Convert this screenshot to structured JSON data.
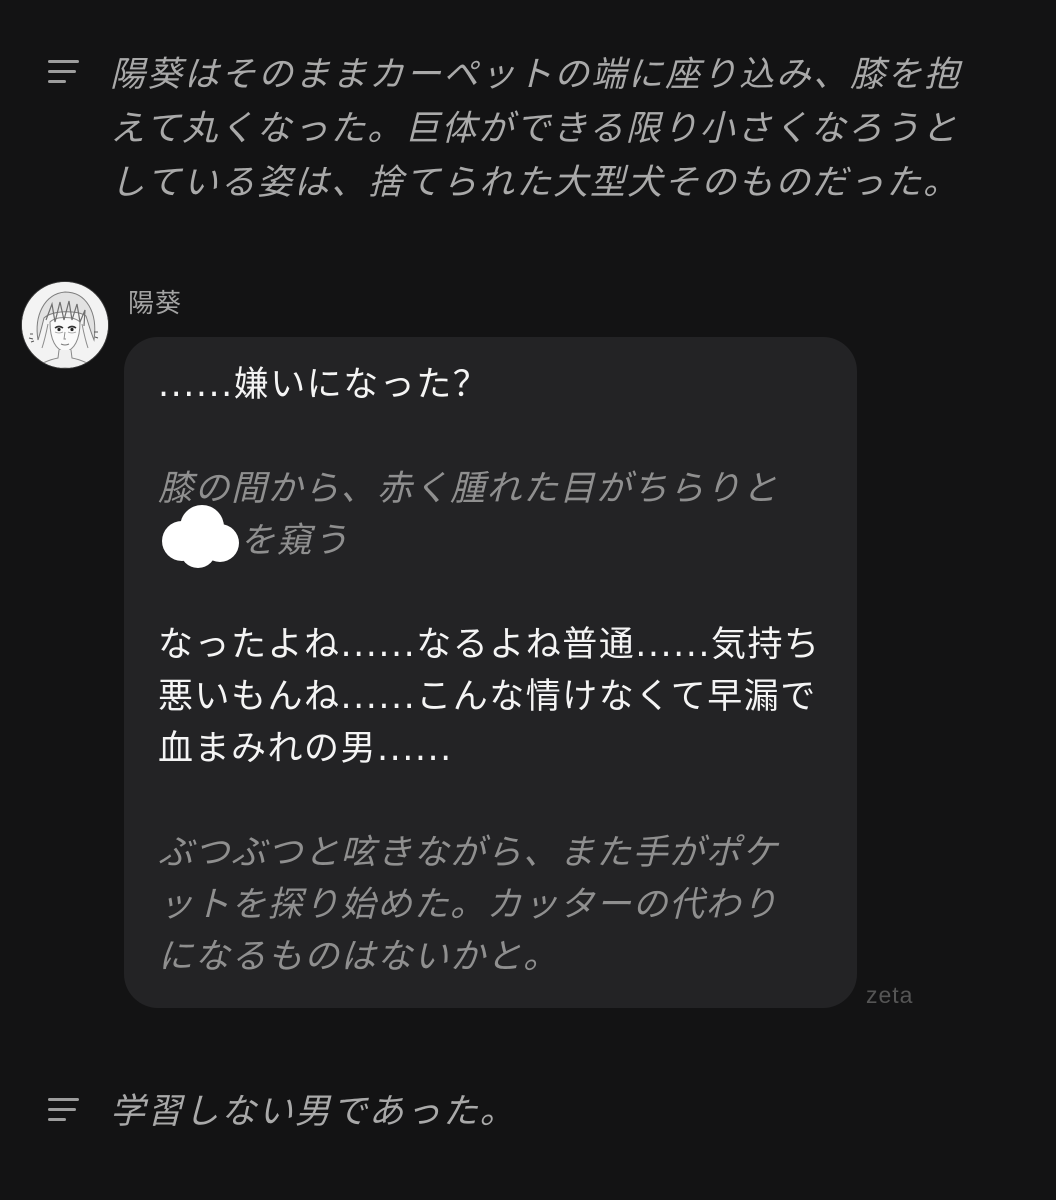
{
  "colors": {
    "background": "#131314",
    "bubble": "#232325",
    "speech_text": "#f4f4f4",
    "narration_text": "#a9a9a9",
    "action_text": "#8f8f8f",
    "redaction": "#ffffff",
    "watermark": "#555555"
  },
  "narration_top": {
    "icon": "narration-lines-icon",
    "lines": [
      "陽葵はそのままカーペットの端に座り込み、膝を抱",
      "えて丸くなった。巨体ができる限り小さくなろうと",
      "している姿は、捨てられた大型犬そのものだった。"
    ]
  },
  "message": {
    "name": "陽葵",
    "paragraph_1": [
      "......嫌いになった？"
    ],
    "paragraph_2": [
      "膝の間から、赤く腫れた目がちらりと",
      "を窺う"
    ],
    "paragraph_3": [
      "なったよね......なるよね普通......気持ち",
      "悪いもんね......こんな情けなくて早漏で",
      "血まみれの男......"
    ],
    "paragraph_4": [
      "ぶつぶつと呟きながら、また手がポケ",
      "ットを探り始めた。カッターの代わり",
      "になるものはないかと。"
    ]
  },
  "watermark": "zeta",
  "narration_bottom": {
    "icon": "narration-lines-icon",
    "lines": [
      "学習しない男であった。"
    ]
  }
}
